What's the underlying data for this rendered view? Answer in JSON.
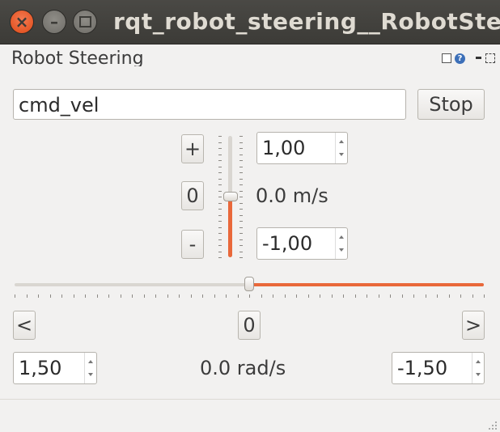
{
  "window": {
    "title": "rqt_robot_steering__RobotSteering - rqt"
  },
  "plugin": {
    "title": "Robot Steering",
    "help_glyph": "?"
  },
  "topic": {
    "value": "cmd_vel"
  },
  "buttons": {
    "stop": "Stop",
    "increase_linear": "+",
    "reset_linear": "0",
    "decrease_linear": "-",
    "increase_angular": "<",
    "reset_angular": "0",
    "decrease_angular": ">"
  },
  "linear": {
    "max": "1,00",
    "min": "-1,00",
    "current_label": "0.0 m/s",
    "slider_fraction": 0.5
  },
  "angular": {
    "max": "1,50",
    "min": "-1,50",
    "current_label": "0.0 rad/s",
    "slider_fraction": 0.5
  },
  "colors": {
    "accent": "#e9683a",
    "close_button": "#df4a16",
    "titlebar": "#3c3b37",
    "background": "#f2f1f0"
  },
  "icons": {
    "close": "close-icon",
    "minimize": "minimize-icon",
    "maximize": "maximize-icon",
    "dock": "dock-icon",
    "help": "help-icon",
    "undock": "undock-icon",
    "close_plugin": "close-plugin-icon"
  }
}
